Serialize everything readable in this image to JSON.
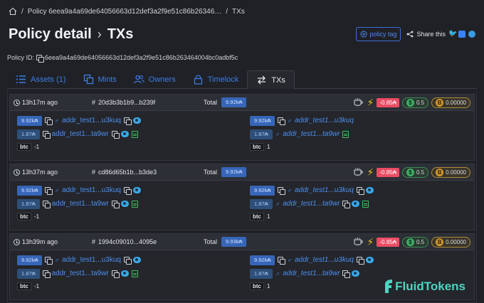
{
  "breadcrumb": {
    "sep": "/",
    "policy": "Policy 6eea9a4a69de64056663d12def3a2f9e51c86b26346…",
    "current": "TXs"
  },
  "header": {
    "title": "Policy detail",
    "subtitle": "TXs",
    "policy_tag_label": "policy tag",
    "share_label": "Share this"
  },
  "policy": {
    "label": "Policy ID:",
    "id": "6eea9a4a69de64056663d12def3a2f9e51c86b263464004bc0adbf5c"
  },
  "tabs": [
    {
      "label": "Assets (1)",
      "icon": "list-icon"
    },
    {
      "label": "Mints",
      "icon": "copy-icon"
    },
    {
      "label": "Owners",
      "icon": "users-icon"
    },
    {
      "label": "Timelock",
      "icon": "lock-icon"
    },
    {
      "label": "TXs",
      "icon": "swap-icon",
      "active": true
    }
  ],
  "transactions": [
    {
      "time": "13h17m ago",
      "hash": "20d3b3b1b9...b239f",
      "total_label": "Total",
      "total": "9.92k₳",
      "delta": "-0.85₳",
      "dollar": "0.5",
      "btc": "0.00000",
      "inputs": [
        {
          "amount": "9.92k₳",
          "address": "addr_test1...u3kuq"
        },
        {
          "amount": "1.87₳",
          "address": "addr_test1...ta9wr"
        }
      ],
      "input_asset": {
        "ticker": "btc",
        "qty": "-1"
      },
      "outputs": [
        {
          "amount": "9.92k₳",
          "address": "addr_test1...u3kuq"
        },
        {
          "amount": "1.87₳",
          "address": "addr_test1...ta9wr"
        }
      ],
      "output_asset": {
        "ticker": "btc",
        "qty": "1"
      }
    },
    {
      "time": "13h37m ago",
      "hash": "cd86d65b1b...b3de3",
      "total_label": "Total",
      "total": "9.92k₳",
      "delta": "-0.85₳",
      "dollar": "0.5",
      "btc": "0.00000",
      "inputs": [
        {
          "amount": "9.92k₳",
          "address": "addr_test1...u3kuq"
        },
        {
          "amount": "1.87₳",
          "address": "addr_test1...ta9wr"
        }
      ],
      "input_asset": {
        "ticker": "btc",
        "qty": "-1"
      },
      "outputs": [
        {
          "amount": "9.92k₳",
          "address": "addr_test1...u3kuq"
        },
        {
          "amount": "1.87₳",
          "address": "addr_test1...ta9wr"
        }
      ],
      "output_asset": {
        "ticker": "btc",
        "qty": "1"
      }
    },
    {
      "time": "13h39m ago",
      "hash": "1994c09010...4095e",
      "total_label": "Total",
      "total": "9.93k₳",
      "delta": "-0.85₳",
      "dollar": "0.5",
      "btc": "0.00000",
      "inputs": [
        {
          "amount": "9.92k₳",
          "address": "addr_test1...u3kuq"
        },
        {
          "amount": "1.87₳",
          "address": "addr_test1...ta9wr"
        }
      ],
      "input_asset": {
        "ticker": "btc",
        "qty": "-1"
      },
      "outputs": [
        {
          "amount": "9.92k₳",
          "address": "addr_test1...u3kuq"
        },
        {
          "amount": "1.87₳",
          "address": "addr_test1...ta9wr"
        }
      ],
      "output_asset": {
        "ticker": "btc",
        "qty": "1"
      }
    }
  ],
  "brand": {
    "name": "FluidTokens"
  },
  "colors": {
    "accent": "#3d7ee6",
    "negative": "#ea4c64",
    "brand": "#4bd5c0"
  }
}
